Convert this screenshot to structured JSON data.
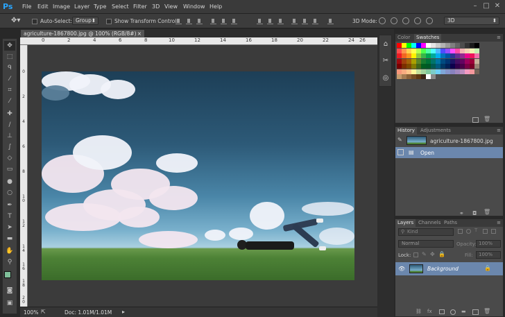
{
  "app": {
    "logo": "Ps"
  },
  "menu": [
    "File",
    "Edit",
    "Image",
    "Layer",
    "Type",
    "Select",
    "Filter",
    "3D",
    "View",
    "Window",
    "Help"
  ],
  "window_controls": {
    "minimize": "–",
    "maximize": "□",
    "close": "✕"
  },
  "options_bar": {
    "auto_select_label": "Auto-Select:",
    "auto_select_value": "Group",
    "show_transform_label": "Show Transform Controls",
    "mode_3d_label": "3D Mode:",
    "workspace_value": "3D"
  },
  "document": {
    "tab_title": "agriculture-1867800.jpg @ 100% (RGB/8#)",
    "tab_close": "×",
    "zoom": "100%",
    "doc_size": "Doc: 1.01M/1.01M"
  },
  "ruler": {
    "top": [
      "0",
      "2",
      "4",
      "6",
      "8",
      "10",
      "12",
      "14",
      "16",
      "18",
      "20",
      "22",
      "24",
      "26"
    ],
    "left": [
      "0",
      "2",
      "4",
      "6",
      "8",
      "1 0",
      "1 2",
      "1 4",
      "1 6",
      "1 8",
      "2 0"
    ]
  },
  "panels": {
    "color_tab": "Color",
    "swatches_tab": "Swatches",
    "history_tab": "History",
    "adjustments_tab": "Adjustments",
    "layers_tab": "Layers",
    "channels_tab": "Channels",
    "paths_tab": "Paths"
  },
  "history": {
    "snapshot": "agriculture-1867800.jpg",
    "items": [
      "Open"
    ]
  },
  "layers": {
    "kind_placeholder": "Kind",
    "blend_mode": "Normal",
    "opacity_label": "Opacity:",
    "opacity_value": "100%",
    "lock_label": "Lock:",
    "fill_label": "Fill:",
    "fill_value": "100%",
    "items": [
      {
        "name": "Background",
        "visible": true,
        "locked": true
      }
    ]
  },
  "swatch_rows": [
    [
      "#ff0000",
      "#ffff00",
      "#00ff00",
      "#00ffff",
      "#0000ff",
      "#ff00ff",
      "#ffffff",
      "#e6e6e6",
      "#cccccc",
      "#b3b3b3",
      "#999999",
      "#808080",
      "#666666",
      "#4d4d4d",
      "#333333",
      "#1a1a1a",
      "#000000"
    ],
    [
      "#ff4d4d",
      "#ff944d",
      "#ffd24d",
      "#ffff4d",
      "#b3ff4d",
      "#4dff4d",
      "#4dffa6",
      "#4dffff",
      "#4db8ff",
      "#4d4dff",
      "#944dff",
      "#ff4dff",
      "#ff4da6",
      "#f2b3b3",
      "#f2d4b3",
      "#f2f2b3",
      "#c6f2b3"
    ],
    [
      "#ed1c24",
      "#f26522",
      "#f7941d",
      "#fff200",
      "#8dc63f",
      "#39b54a",
      "#00a651",
      "#00a99d",
      "#00aeef",
      "#0072bc",
      "#0054a6",
      "#2e3192",
      "#662d91",
      "#92278f",
      "#ec008c",
      "#ed145b",
      "#f06eaa"
    ],
    [
      "#9e0b0f",
      "#a0410d",
      "#a36209",
      "#aba000",
      "#598527",
      "#197b30",
      "#007236",
      "#00746b",
      "#0076a3",
      "#004a80",
      "#003471",
      "#1b1464",
      "#440e62",
      "#630460",
      "#9e005d",
      "#9e0039",
      "#c6b29a"
    ],
    [
      "#790000",
      "#7b2e00",
      "#7d4900",
      "#827b00",
      "#406618",
      "#005e20",
      "#005826",
      "#005952",
      "#005b7f",
      "#003663",
      "#002157",
      "#0d004c",
      "#32004b",
      "#4b0049",
      "#7b0046",
      "#7a0026",
      "#998675"
    ],
    [
      "#f7977a",
      "#f9ad81",
      "#fdc68a",
      "#fff79a",
      "#c4df9b",
      "#a3d39c",
      "#82ca9d",
      "#7bcdc8",
      "#6ecff6",
      "#7ea7d8",
      "#8493ca",
      "#8882be",
      "#a187be",
      "#bc8dbf",
      "#f49ac2",
      "#f6989d",
      "#736357"
    ],
    [
      "#c69c6d",
      "#a67c52",
      "#8c6239",
      "#754c24",
      "#603913",
      "#3c2415",
      "#ffffff",
      "#8a8a8a",
      "#4d4d4d"
    ]
  ]
}
